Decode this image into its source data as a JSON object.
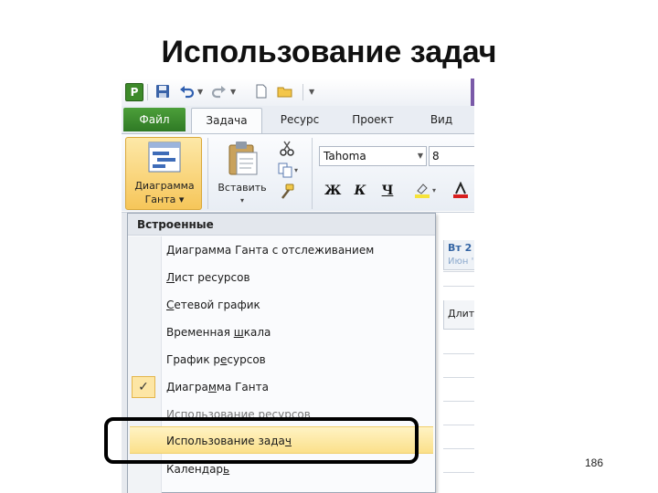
{
  "slide": {
    "title": "Использование задач",
    "page_number": "186"
  },
  "tabs": {
    "file": "Файл",
    "task": "Задача",
    "resource": "Ресурс",
    "project": "Проект",
    "view": "Вид",
    "active": "Задача"
  },
  "app_icon": "P",
  "ribbon": {
    "gantt_line1": "Диаграмма",
    "gantt_line2": "Ганта ▾",
    "paste_label": "Вставить",
    "paste_arrow": "▾",
    "font_name": "Tahoma",
    "font_size": "8",
    "bold": "Ж",
    "italic": "К",
    "underline": "Ч"
  },
  "background": {
    "timescale_top": "Вт 2",
    "timescale_bottom": "Июн '",
    "column_header": "Длит"
  },
  "menu": {
    "header": "Встроенные",
    "items": [
      {
        "pre": "",
        "ul": "Д",
        "post": "иаграмма Ганта с отслеживанием"
      },
      {
        "pre": "",
        "ul": "Л",
        "post": "ист ресурсов"
      },
      {
        "pre": "",
        "ul": "С",
        "post": "етевой график"
      },
      {
        "pre": "Временная ",
        "ul": "ш",
        "post": "кала"
      },
      {
        "pre": "График р",
        "ul": "е",
        "post": "сурсов"
      },
      {
        "pre": "Диагра",
        "ul": "м",
        "post": "ма Ганта"
      },
      {
        "pre": "Использ",
        "ul": "о",
        "post": "вание ресурсов"
      },
      {
        "pre": "Использование зада",
        "ul": "ч",
        "post": ""
      },
      {
        "pre": "Календар",
        "ul": "ь",
        "post": ""
      }
    ],
    "checked_index": 5,
    "selected_index": 7,
    "check_mark": "✓"
  },
  "colors": {
    "file_tab": "#2f7a25",
    "selected_item": "#fbe08a",
    "highlight_frame": "#000000"
  }
}
